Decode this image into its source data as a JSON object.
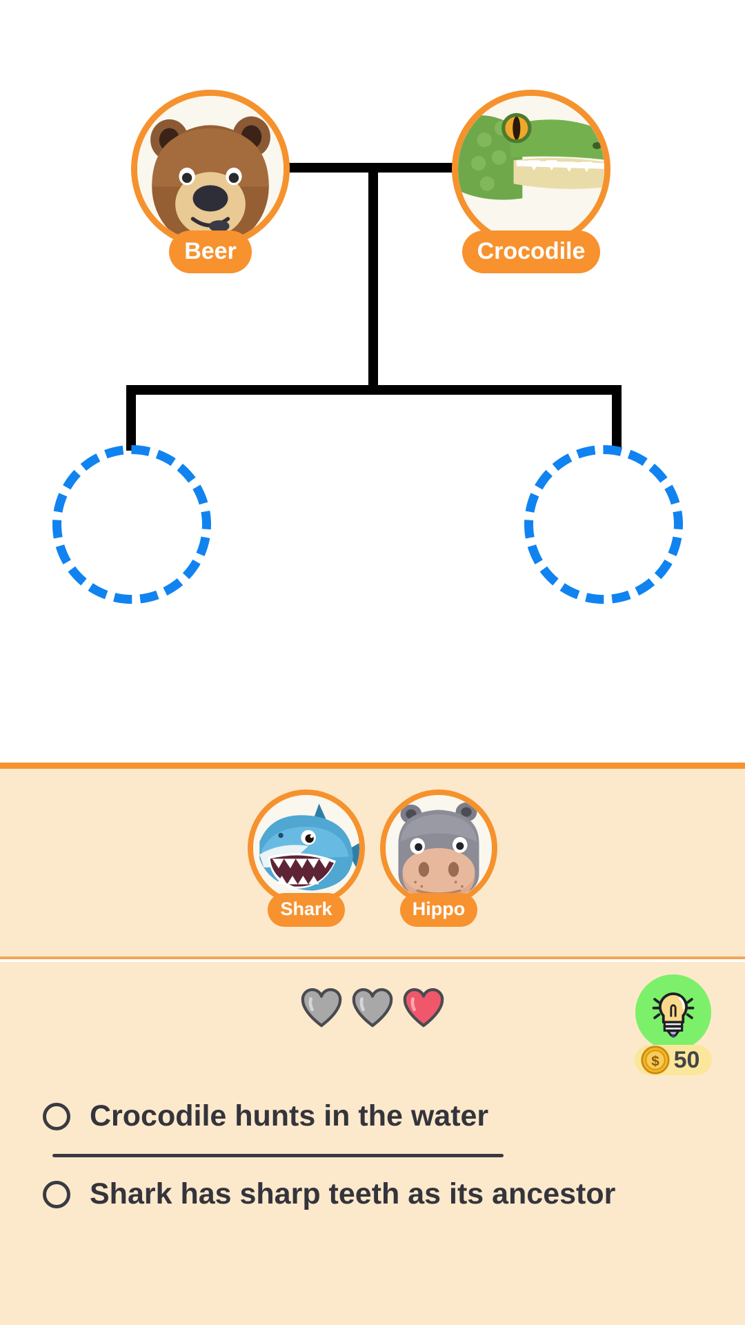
{
  "theme": {
    "page_bg": "#FFFFFF",
    "accent_orange": "#F7922F",
    "tray_bg": "#FCE9CB",
    "slot_blue": "#1083F0",
    "line_black": "#000000",
    "hint_green": "#7CF06A",
    "heart_red": "#F0576B",
    "heart_gray": "#A8A8A8",
    "text_dark": "#34343C"
  },
  "tree": {
    "parents": [
      {
        "name": "Beer",
        "icon": "bear-avatar"
      },
      {
        "name": "Crocodile",
        "icon": "crocodile-avatar"
      }
    ],
    "empty_slots": [
      {
        "label": "",
        "icon": "empty-slot-left"
      },
      {
        "label": "",
        "icon": "empty-slot-right"
      }
    ]
  },
  "tray": {
    "cards": [
      {
        "name": "Shark",
        "icon": "shark-avatar"
      },
      {
        "name": "Hippo",
        "icon": "hippo-avatar"
      }
    ]
  },
  "status": {
    "hearts": [
      "empty",
      "empty",
      "full"
    ],
    "hint": {
      "icon": "lightbulb-icon",
      "coin_icon": "coin-icon",
      "coin_symbol": "$",
      "cost": "50"
    }
  },
  "quiz": {
    "options": [
      {
        "text": "Crocodile hunts in the water",
        "selected": false
      },
      {
        "text": "Shark has sharp teeth as its ancestor",
        "selected": false
      }
    ]
  }
}
